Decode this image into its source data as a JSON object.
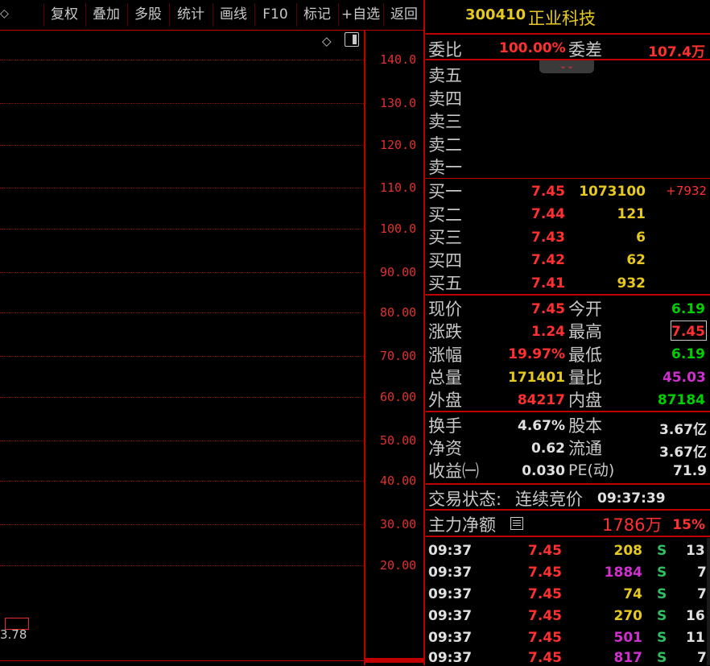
{
  "toolbar": {
    "lead_glyph": "◇",
    "buttons": [
      "复权",
      "叠加",
      "多股",
      "统计",
      "画线",
      "F10",
      "标记",
      "+自选",
      "返回"
    ]
  },
  "chart": {
    "corner_icons": [
      "◇",
      "◨"
    ],
    "y_labels": [
      "140.0",
      "130.0",
      "120.0",
      "110.0",
      "100.0",
      "90.00",
      "80.00",
      "70.00",
      "60.00",
      "50.00",
      "40.00",
      "30.00",
      "20.00"
    ],
    "bottom_label": "3.78",
    "marker_icon": "price-box-icon"
  },
  "quote": {
    "code": "300410",
    "name": "正业科技",
    "weibi_label": "委比",
    "weibi_value": "100.00%",
    "weicha_label": "委差",
    "weicha_value": "107.4万",
    "sells": [
      {
        "label": "卖五"
      },
      {
        "label": "卖四"
      },
      {
        "label": "卖三"
      },
      {
        "label": "卖二"
      },
      {
        "label": "卖一"
      }
    ],
    "buys": [
      {
        "label": "买一",
        "price": "7.45",
        "vol": "1073100",
        "chg": "+7932"
      },
      {
        "label": "买二",
        "price": "7.44",
        "vol": "121",
        "chg": ""
      },
      {
        "label": "买三",
        "price": "7.43",
        "vol": "6",
        "chg": ""
      },
      {
        "label": "买四",
        "price": "7.42",
        "vol": "62",
        "chg": ""
      },
      {
        "label": "买五",
        "price": "7.41",
        "vol": "932",
        "chg": ""
      }
    ],
    "stats": [
      {
        "l1": "现价",
        "v1": "7.45",
        "l2": "今开",
        "v2": "6.19"
      },
      {
        "l1": "涨跌",
        "v1": "1.24",
        "l2": "最高",
        "v2": "7.45"
      },
      {
        "l1": "涨幅",
        "v1": "19.97%",
        "l2": "最低",
        "v2": "6.19"
      },
      {
        "l1": "总量",
        "v1": "171401",
        "l2": "量比",
        "v2": "45.03"
      },
      {
        "l1": "外盘",
        "v1": "84217",
        "l2": "内盘",
        "v2": "87184"
      }
    ],
    "fundamentals": [
      {
        "l1": "换手",
        "v1": "4.67%",
        "l2": "股本",
        "v2": "3.67亿"
      },
      {
        "l1": "净资",
        "v1": "0.62",
        "l2": "流通",
        "v2": "3.67亿"
      },
      {
        "l1": "收益㈠",
        "v1": "0.030",
        "l2": "PE(动)",
        "v2": "71.9"
      }
    ],
    "status_label": "交易状态:",
    "status_value": "连续竞价",
    "status_time": "09:37:39",
    "net_label": "主力净额",
    "net_value": "1786万",
    "net_pct": "15%",
    "ticks": [
      {
        "time": "09:37",
        "price": "7.45",
        "vol": "208",
        "side": "S",
        "count": "13"
      },
      {
        "time": "09:37",
        "price": "7.45",
        "vol": "1884",
        "side": "S",
        "count": "7"
      },
      {
        "time": "09:37",
        "price": "7.45",
        "vol": "74",
        "side": "S",
        "count": "7"
      },
      {
        "time": "09:37",
        "price": "7.45",
        "vol": "270",
        "side": "S",
        "count": "16"
      },
      {
        "time": "09:37",
        "price": "7.45",
        "vol": "501",
        "side": "S",
        "count": "11"
      },
      {
        "time": "09:37",
        "price": "7.45",
        "vol": "817",
        "side": "S",
        "count": "7"
      }
    ],
    "colors": {
      "up": "#ff3030",
      "down": "#00d000",
      "volume": "#e6c81e",
      "big_volume": "#d030d0",
      "frame": "#c00000"
    }
  }
}
